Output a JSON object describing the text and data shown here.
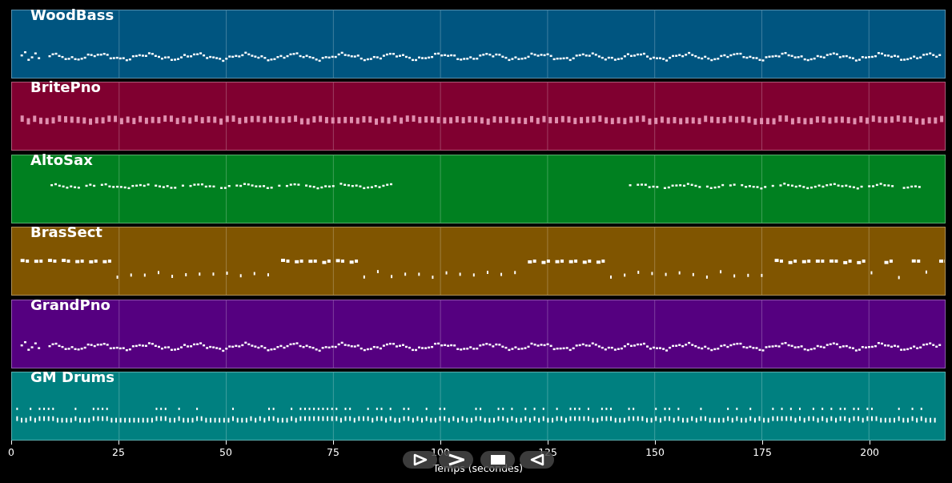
{
  "tracks": [
    {
      "name": "WoodBass",
      "color": "#005580",
      "kind": "wave"
    },
    {
      "name": "BritePno",
      "color": "#800030",
      "kind": "blocks"
    },
    {
      "name": "AltoSax",
      "color": "#008020",
      "kind": "phrases"
    },
    {
      "name": "BrasSect",
      "color": "#805500",
      "kind": "stabs"
    },
    {
      "name": "GrandPno",
      "color": "#550080",
      "kind": "wave"
    },
    {
      "name": "GM Drums",
      "color": "#008080",
      "kind": "drums"
    }
  ],
  "axis": {
    "ticks": [
      "0",
      "25",
      "50",
      "75",
      "100",
      "125",
      "150",
      "175",
      "200"
    ],
    "label": "Temps (secondes)"
  },
  "controls": [
    {
      "kind": "play"
    },
    {
      "kind": "forward"
    },
    {
      "kind": "stop"
    },
    {
      "kind": "reverse"
    }
  ]
}
